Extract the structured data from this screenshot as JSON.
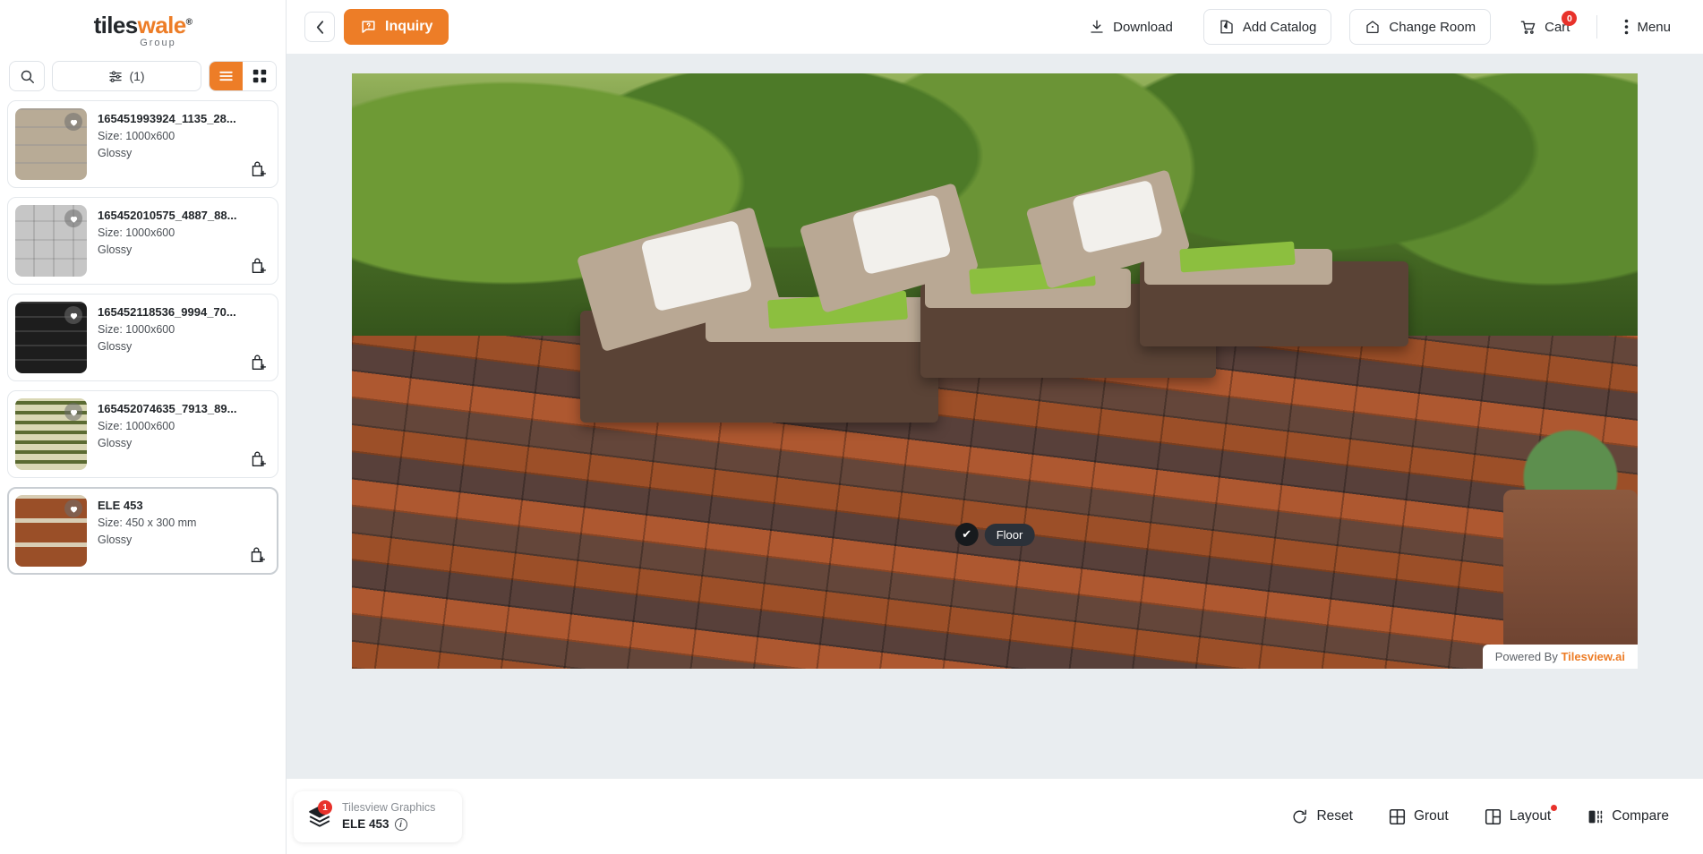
{
  "brand": {
    "logo_part1": "tiles",
    "logo_part2": "wale",
    "logo_registered": "®",
    "logo_sub": "Group"
  },
  "sidebar": {
    "search_icon": "search-icon",
    "filter_label": "(1)",
    "filter_icon": "sliders-icon",
    "view_list_icon": "list-view-icon",
    "view_grid_icon": "grid-view-icon",
    "products": [
      {
        "title": "165451993924_1135_28...",
        "size": "Size: 1000x600",
        "finish": "Glossy",
        "texture": "tex1",
        "selected": false
      },
      {
        "title": "165452010575_4887_88...",
        "size": "Size: 1000x600",
        "finish": "Glossy",
        "texture": "tex2",
        "selected": false
      },
      {
        "title": "165452118536_9994_70...",
        "size": "Size: 1000x600",
        "finish": "Glossy",
        "texture": "tex3",
        "selected": false
      },
      {
        "title": "165452074635_7913_89...",
        "size": "Size: 1000x600",
        "finish": "Glossy",
        "texture": "tex4",
        "selected": false
      },
      {
        "title": "ELE 453",
        "size": "Size: 450 x 300 mm",
        "finish": "Glossy",
        "texture": "tex5",
        "selected": true
      }
    ]
  },
  "topbar": {
    "back_icon": "chevron-left-icon",
    "inquiry_label": "Inquiry",
    "inquiry_icon": "chat-question-icon",
    "download_label": "Download",
    "download_icon": "download-icon",
    "add_catalog_label": "Add Catalog",
    "add_catalog_icon": "catalog-book-icon",
    "change_room_label": "Change Room",
    "change_room_icon": "house-icon",
    "cart_label": "Cart",
    "cart_icon": "cart-icon",
    "cart_badge": "0",
    "menu_label": "Menu",
    "menu_icon": "kebab-menu-icon"
  },
  "canvas": {
    "surface_chip_label": "Floor",
    "surface_chip_check": "✔",
    "watermark_prefix": "Powered By ",
    "watermark_brand": "Tilesview.ai"
  },
  "bottombar": {
    "layer_badge": "1",
    "layer_icon": "layers-icon",
    "layer_group": "Tilesview Graphics",
    "layer_tile": "ELE 453",
    "layer_info_icon": "info-icon",
    "info_glyph": "i",
    "actions": [
      {
        "label": "Reset",
        "icon": "reset-icon",
        "badge": false
      },
      {
        "label": "Grout",
        "icon": "grout-grid-icon",
        "badge": false
      },
      {
        "label": "Layout",
        "icon": "layout-grid-icon",
        "badge": true
      },
      {
        "label": "Compare",
        "icon": "compare-split-icon",
        "badge": false
      }
    ]
  },
  "colors": {
    "accent": "#ED7D27",
    "badge_red": "#E8322B",
    "canvas_bg": "#E9EDF0",
    "border": "#DFE3E8"
  }
}
